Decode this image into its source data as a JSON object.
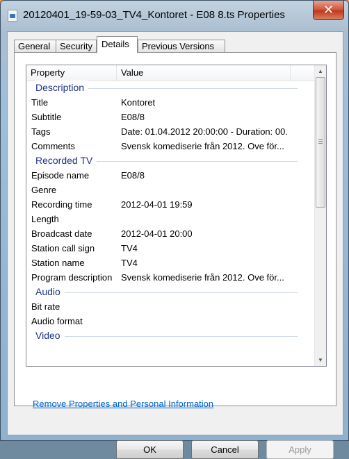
{
  "window": {
    "title": "20120401_19-59-03_TV4_Kontoret - E08 8.ts Properties",
    "close_label": "✕"
  },
  "tabs": [
    "General",
    "Security",
    "Details",
    "Previous Versions"
  ],
  "active_tab": "Details",
  "columns": {
    "property": "Property",
    "value": "Value"
  },
  "groups": [
    {
      "name": "Description",
      "rows": [
        {
          "k": "Title",
          "v": "Kontoret"
        },
        {
          "k": "Subtitle",
          "v": "E08/8"
        },
        {
          "k": "Tags",
          "v": "Date: 01.04.2012 20:00:00 - Duration: 00..."
        },
        {
          "k": "Comments",
          "v": "Svensk komediserie från 2012. Ove för..."
        }
      ]
    },
    {
      "name": "Recorded TV",
      "rows": [
        {
          "k": "Episode name",
          "v": "E08/8"
        },
        {
          "k": "Genre",
          "v": ""
        },
        {
          "k": "Recording time",
          "v": "2012-04-01 19:59"
        },
        {
          "k": "Length",
          "v": ""
        },
        {
          "k": "Broadcast date",
          "v": "2012-04-01 20:00"
        },
        {
          "k": "Station call sign",
          "v": "TV4"
        },
        {
          "k": "Station name",
          "v": "TV4"
        },
        {
          "k": "Program description",
          "v": "Svensk komediserie från 2012. Ove för..."
        }
      ]
    },
    {
      "name": "Audio",
      "rows": [
        {
          "k": "Bit rate",
          "v": ""
        },
        {
          "k": "Audio format",
          "v": ""
        }
      ]
    },
    {
      "name": "Video",
      "rows": []
    }
  ],
  "link": "Remove Properties and Personal Information",
  "buttons": {
    "ok": "OK",
    "cancel": "Cancel",
    "apply": "Apply"
  }
}
